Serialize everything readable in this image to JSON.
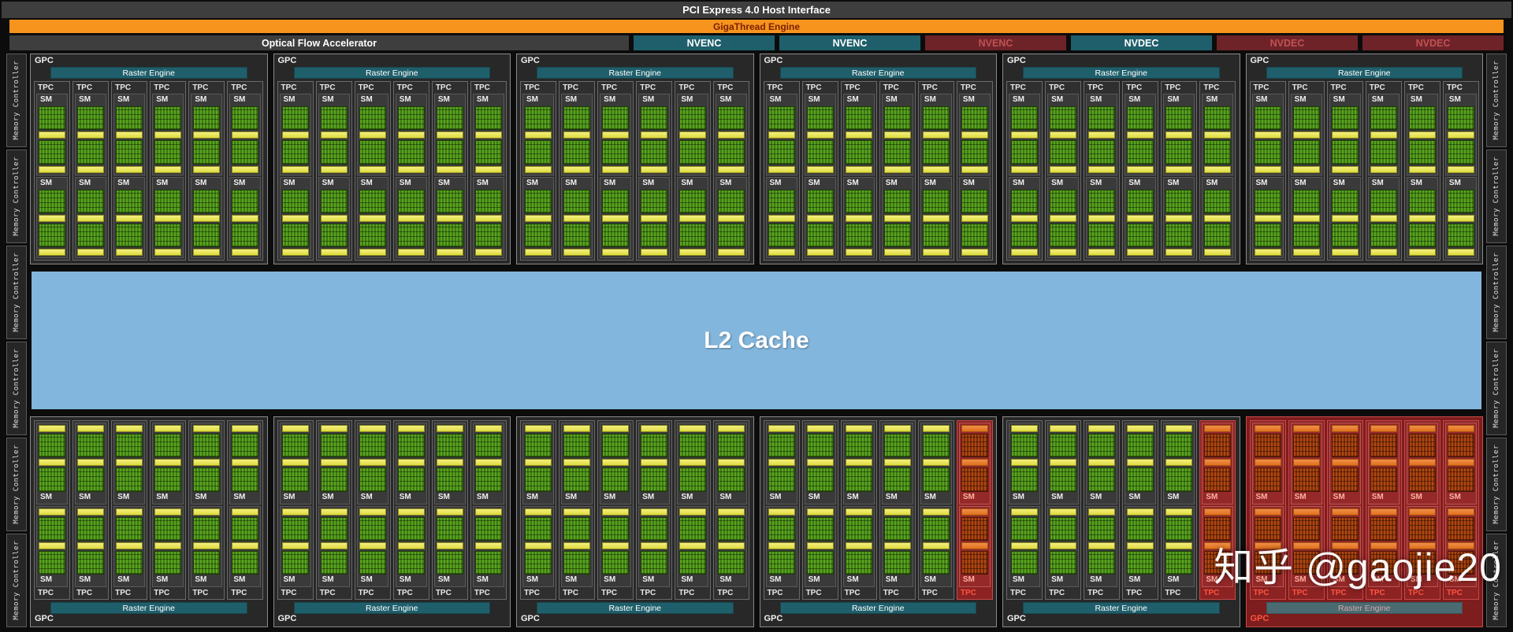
{
  "header": {
    "pci_label": "PCI Express 4.0 Host Interface",
    "gigathread_label": "GigaThread Engine",
    "ofa_label": "Optical Flow Accelerator",
    "codecs": [
      {
        "label": "NVENC",
        "state": "on"
      },
      {
        "label": "NVENC",
        "state": "on"
      },
      {
        "label": "NVENC",
        "state": "off"
      },
      {
        "label": "NVDEC",
        "state": "on"
      },
      {
        "label": "NVDEC",
        "state": "off"
      },
      {
        "label": "NVDEC",
        "state": "off"
      }
    ]
  },
  "memory": {
    "label": "Memory Controller",
    "left_count": 6,
    "right_count": 6
  },
  "l2": {
    "label": "L2 Cache"
  },
  "labels": {
    "gpc": "GPC",
    "raster": "Raster Engine",
    "tpc": "TPC",
    "sm": "SM"
  },
  "gpc_rows": {
    "top": [
      {
        "off": false,
        "tpcs": [
          "on",
          "on",
          "on",
          "on",
          "on",
          "on"
        ]
      },
      {
        "off": false,
        "tpcs": [
          "on",
          "on",
          "on",
          "on",
          "on",
          "on"
        ]
      },
      {
        "off": false,
        "tpcs": [
          "on",
          "on",
          "on",
          "on",
          "on",
          "on"
        ]
      },
      {
        "off": false,
        "tpcs": [
          "on",
          "on",
          "on",
          "on",
          "on",
          "on"
        ]
      },
      {
        "off": false,
        "tpcs": [
          "on",
          "on",
          "on",
          "on",
          "on",
          "on"
        ]
      },
      {
        "off": false,
        "tpcs": [
          "on",
          "on",
          "on",
          "on",
          "on",
          "on"
        ]
      }
    ],
    "bottom": [
      {
        "off": false,
        "tpcs": [
          "on",
          "on",
          "on",
          "on",
          "on",
          "on"
        ]
      },
      {
        "off": false,
        "tpcs": [
          "on",
          "on",
          "on",
          "on",
          "on",
          "on"
        ]
      },
      {
        "off": false,
        "tpcs": [
          "on",
          "on",
          "on",
          "on",
          "on",
          "on"
        ]
      },
      {
        "off": false,
        "tpcs": [
          "on",
          "on",
          "on",
          "on",
          "on",
          "off"
        ]
      },
      {
        "off": false,
        "tpcs": [
          "on",
          "on",
          "on",
          "on",
          "on",
          "off"
        ]
      },
      {
        "off": true,
        "tpcs": [
          "off",
          "off",
          "off",
          "off",
          "off",
          "off"
        ]
      }
    ]
  },
  "watermark": "知乎 @gaojie20",
  "colors": {
    "accent_orange": "#f7941e",
    "teal": "#1f5f6b",
    "disabled_red": "#6e2329",
    "l2_blue": "#82b6dc",
    "sm_green": "#5ba320",
    "sm_yellow": "#e8e44f",
    "disabled_block_orange": "#e0701c"
  }
}
